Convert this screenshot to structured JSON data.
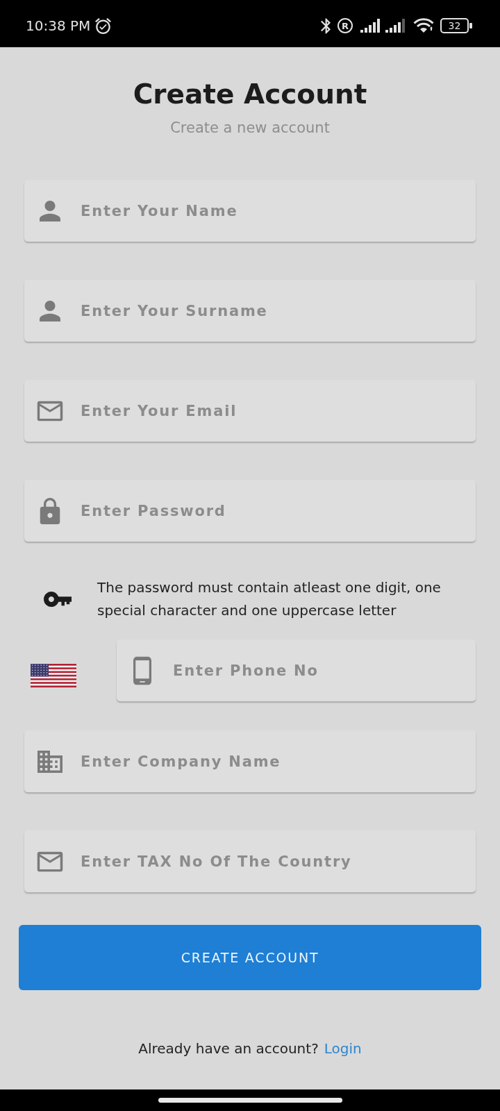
{
  "status_bar": {
    "time": "10:38 PM",
    "roaming": "R",
    "battery": "32"
  },
  "header": {
    "title": "Create Account",
    "subtitle": "Create a new account"
  },
  "form": [
    {
      "kind": "name",
      "placeholder": "Enter Your Name"
    },
    {
      "kind": "name",
      "placeholder": "Enter Your Surname"
    },
    {
      "kind": "email",
      "placeholder": "Enter Your Email"
    },
    {
      "kind": "password",
      "placeholder": "Enter Password"
    },
    {
      "kind": "hint",
      "text": "The password must contain atleast one digit, one special character and one uppercase letter"
    },
    {
      "kind": "phone",
      "placeholder": "Enter Phone No"
    },
    {
      "kind": "company",
      "placeholder": "Enter Company Name"
    },
    {
      "kind": "tax",
      "placeholder": "Enter TAX No Of The Country"
    }
  ],
  "submit_button": {
    "label": "CREATE ACCOUNT"
  },
  "footer": {
    "text": "Already have an account?",
    "link": "Login"
  }
}
